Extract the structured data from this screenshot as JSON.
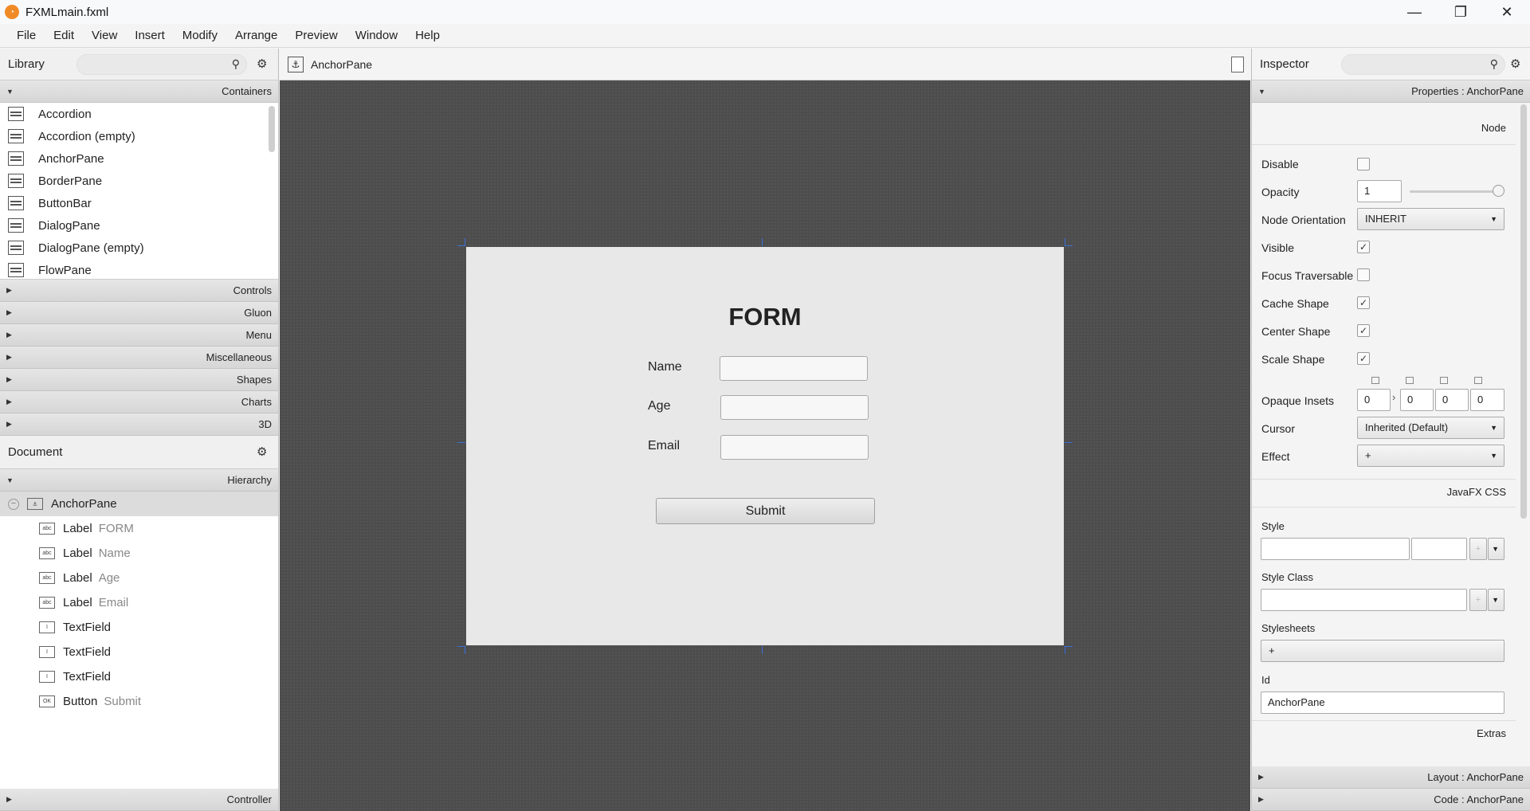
{
  "window": {
    "title": "FXMLmain.fxml",
    "minimize": "—",
    "maximize": "❐",
    "close": "✕"
  },
  "menu": [
    "File",
    "Edit",
    "View",
    "Insert",
    "Modify",
    "Arrange",
    "Preview",
    "Window",
    "Help"
  ],
  "library": {
    "title": "Library",
    "sections": {
      "containers": "Containers",
      "controls": "Controls",
      "gluon": "Gluon",
      "menu": "Menu",
      "misc": "Miscellaneous",
      "shapes": "Shapes",
      "charts": "Charts",
      "threed": "3D"
    },
    "items": [
      "Accordion",
      "Accordion  (empty)",
      "AnchorPane",
      "BorderPane",
      "ButtonBar",
      "DialogPane",
      "DialogPane  (empty)",
      "FlowPane"
    ]
  },
  "document": {
    "title": "Document",
    "hierarchy_label": "Hierarchy",
    "controller_label": "Controller",
    "root": "AnchorPane",
    "nodes": [
      {
        "type": "Label",
        "text": "FORM",
        "icon": "abc"
      },
      {
        "type": "Label",
        "text": "Name",
        "icon": "abc"
      },
      {
        "type": "Label",
        "text": "Age",
        "icon": "abc"
      },
      {
        "type": "Label",
        "text": "Email",
        "icon": "abc"
      },
      {
        "type": "TextField",
        "text": "",
        "icon": "I"
      },
      {
        "type": "TextField",
        "text": "",
        "icon": "I"
      },
      {
        "type": "TextField",
        "text": "",
        "icon": "I"
      },
      {
        "type": "Button",
        "text": "Submit",
        "icon": "OK"
      }
    ]
  },
  "canvas": {
    "breadcrumb": "AnchorPane",
    "form_title": "FORM",
    "name_label": "Name",
    "age_label": "Age",
    "email_label": "Email",
    "submit_label": "Submit"
  },
  "inspector": {
    "title": "Inspector",
    "properties_header": "Properties : AnchorPane",
    "node_group": "Node",
    "disable": "Disable",
    "opacity": "Opacity",
    "opacity_value": "1",
    "node_orientation": "Node Orientation",
    "node_orientation_value": "INHERIT",
    "visible": "Visible",
    "focus_traversable": "Focus Traversable",
    "cache_shape": "Cache Shape",
    "center_shape": "Center Shape",
    "scale_shape": "Scale Shape",
    "opaque_insets": "Opaque Insets",
    "insets": [
      "0",
      "0",
      "0",
      "0"
    ],
    "cursor": "Cursor",
    "cursor_value": "Inherited (Default)",
    "effect": "Effect",
    "effect_value": "+",
    "css_group": "JavaFX CSS",
    "style": "Style",
    "style_class": "Style Class",
    "stylesheets": "Stylesheets",
    "stylesheets_value": "+",
    "id": "Id",
    "id_value": "AnchorPane",
    "extras": "Extras",
    "layout_header": "Layout : AnchorPane",
    "code_header": "Code : AnchorPane",
    "checked_mark": "✓"
  }
}
